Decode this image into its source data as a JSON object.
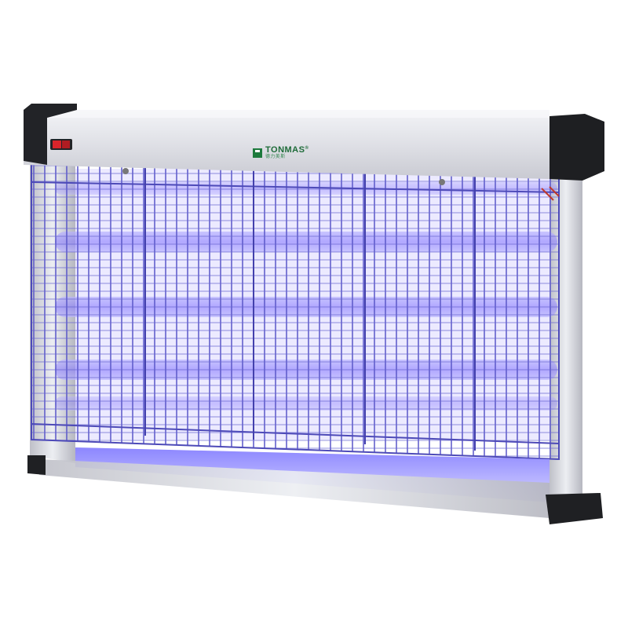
{
  "product": {
    "type": "electric insect killer",
    "brand": "TONMAS",
    "brand_mark": "®",
    "brand_subtitle": "德力美斯",
    "colors": {
      "housing": "#e6e7ec",
      "end_caps": "#1f2023",
      "grid": "#5a57c8",
      "uv_glow": "#7b6bff",
      "switch": "#d9242b",
      "logo": "#1d7a3d"
    }
  }
}
